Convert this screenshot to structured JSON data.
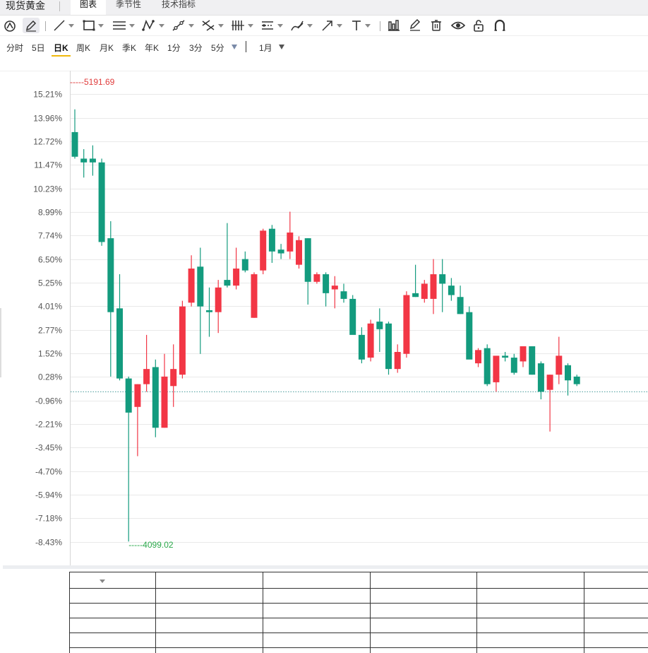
{
  "app": {
    "title": "现货黄金"
  },
  "tabs": [
    {
      "label": "图表",
      "active": true
    },
    {
      "label": "季节性",
      "active": false
    },
    {
      "label": "技术指标",
      "active": false
    }
  ],
  "toolbar": {
    "tools": [
      "magnet-icon",
      "pencil-icon",
      "line-icon",
      "rectangle-icon",
      "parallel-channel-icon",
      "pattern-icon",
      "fib-icon",
      "pitchfork-icon",
      "gann-icon",
      "projection-icon",
      "brush-icon",
      "arrow-icon",
      "text-icon",
      "measure-icon",
      "eraser-icon",
      "trash-icon",
      "eye-icon",
      "lock-icon",
      "magnet-u-icon"
    ]
  },
  "periods": {
    "items": [
      "分时",
      "5日",
      "日K",
      "周K",
      "月K",
      "季K",
      "年K",
      "1分",
      "3分",
      "5分"
    ],
    "active": "日K",
    "range_label": "1月"
  },
  "chart_data": {
    "type": "candlestick",
    "y_axis_format": "percent",
    "ylim": [
      -9.4,
      16.6
    ],
    "y_ticks": [
      "15.21%",
      "13.96%",
      "12.72%",
      "11.47%",
      "10.23%",
      "8.99%",
      "7.74%",
      "6.50%",
      "5.25%",
      "4.01%",
      "2.77%",
      "1.52%",
      "0.28%",
      "-0.96%",
      "-2.21%",
      "-3.45%",
      "-4.70%",
      "-5.94%",
      "-7.18%",
      "-8.43%"
    ],
    "y_tick_values": [
      15.21,
      13.96,
      12.72,
      11.47,
      10.23,
      8.99,
      7.74,
      6.5,
      5.25,
      4.01,
      2.77,
      1.52,
      0.28,
      -0.96,
      -2.21,
      -3.45,
      -4.7,
      -5.94,
      -7.18,
      -8.43
    ],
    "baseline_pct": 0.0,
    "max_label": "5191.69",
    "min_label": "4099.02",
    "up_color": "#f23645",
    "down_color": "#139b7e",
    "candles": [
      {
        "o": 13.2,
        "h": 14.4,
        "l": 11.8,
        "c": 11.9
      },
      {
        "o": 11.8,
        "h": 12.3,
        "l": 10.8,
        "c": 11.6
      },
      {
        "o": 11.8,
        "h": 12.5,
        "l": 10.9,
        "c": 11.6
      },
      {
        "o": 11.6,
        "h": 11.8,
        "l": 7.2,
        "c": 7.4
      },
      {
        "o": 7.6,
        "h": 8.5,
        "l": 0.3,
        "c": 3.7
      },
      {
        "o": 3.9,
        "h": 5.7,
        "l": 0.1,
        "c": 0.2
      },
      {
        "o": 0.2,
        "h": 0.3,
        "l": -8.4,
        "c": -1.6
      },
      {
        "o": -1.3,
        "h": -0.1,
        "l": -3.9,
        "c": -0.1
      },
      {
        "o": -0.1,
        "h": 2.5,
        "l": -0.5,
        "c": 0.7
      },
      {
        "o": 0.8,
        "h": 1.2,
        "l": -2.9,
        "c": -2.4
      },
      {
        "o": -2.4,
        "h": 1.5,
        "l": -2.4,
        "c": 0.3
      },
      {
        "o": -0.2,
        "h": 2.0,
        "l": -1.3,
        "c": 0.7
      },
      {
        "o": 0.4,
        "h": 4.3,
        "l": 0.2,
        "c": 4.0
      },
      {
        "o": 4.2,
        "h": 6.7,
        "l": 4.0,
        "c": 6.0
      },
      {
        "o": 6.1,
        "h": 7.1,
        "l": 1.5,
        "c": 4.0
      },
      {
        "o": 3.8,
        "h": 5.0,
        "l": 2.4,
        "c": 3.7
      },
      {
        "o": 3.7,
        "h": 5.4,
        "l": 2.6,
        "c": 5.0
      },
      {
        "o": 5.4,
        "h": 8.4,
        "l": 5.0,
        "c": 5.1
      },
      {
        "o": 5.1,
        "h": 7.1,
        "l": 4.9,
        "c": 6.0
      },
      {
        "o": 6.5,
        "h": 6.9,
        "l": 5.8,
        "c": 5.9
      },
      {
        "o": 3.4,
        "h": 5.8,
        "l": 3.4,
        "c": 5.7
      },
      {
        "o": 5.9,
        "h": 8.1,
        "l": 5.7,
        "c": 8.0
      },
      {
        "o": 8.1,
        "h": 8.3,
        "l": 6.3,
        "c": 6.9
      },
      {
        "o": 7.0,
        "h": 7.3,
        "l": 6.5,
        "c": 6.8
      },
      {
        "o": 6.9,
        "h": 9.0,
        "l": 6.5,
        "c": 7.9
      },
      {
        "o": 6.2,
        "h": 7.7,
        "l": 6.0,
        "c": 7.5
      },
      {
        "o": 7.6,
        "h": 7.6,
        "l": 4.1,
        "c": 5.3
      },
      {
        "o": 5.3,
        "h": 5.8,
        "l": 5.2,
        "c": 5.7
      },
      {
        "o": 5.7,
        "h": 5.8,
        "l": 4.0,
        "c": 4.7
      },
      {
        "o": 4.9,
        "h": 5.6,
        "l": 3.9,
        "c": 5.1
      },
      {
        "o": 4.8,
        "h": 5.2,
        "l": 4.2,
        "c": 4.4
      },
      {
        "o": 4.4,
        "h": 4.6,
        "l": 2.6,
        "c": 2.5
      },
      {
        "o": 2.5,
        "h": 2.9,
        "l": 1.0,
        "c": 1.2
      },
      {
        "o": 1.3,
        "h": 3.3,
        "l": 1.1,
        "c": 3.1
      },
      {
        "o": 3.2,
        "h": 3.9,
        "l": 1.6,
        "c": 2.8
      },
      {
        "o": 3.1,
        "h": 3.2,
        "l": 0.4,
        "c": 0.7
      },
      {
        "o": 0.7,
        "h": 2.0,
        "l": 0.5,
        "c": 1.6
      },
      {
        "o": 1.5,
        "h": 4.8,
        "l": 1.3,
        "c": 4.6
      },
      {
        "o": 4.7,
        "h": 6.2,
        "l": 4.5,
        "c": 4.5
      },
      {
        "o": 4.4,
        "h": 5.4,
        "l": 4.2,
        "c": 5.2
      },
      {
        "o": 4.4,
        "h": 6.5,
        "l": 3.6,
        "c": 5.7
      },
      {
        "o": 5.7,
        "h": 6.5,
        "l": 3.7,
        "c": 5.2
      },
      {
        "o": 5.1,
        "h": 5.5,
        "l": 4.3,
        "c": 4.6
      },
      {
        "o": 4.5,
        "h": 5.1,
        "l": 3.6,
        "c": 3.6
      },
      {
        "o": 3.7,
        "h": 4.0,
        "l": 1.4,
        "c": 1.2
      },
      {
        "o": 1.0,
        "h": 1.8,
        "l": 0.8,
        "c": 1.7
      },
      {
        "o": 1.8,
        "h": 2.0,
        "l": -0.2,
        "c": -0.1
      },
      {
        "o": 0.0,
        "h": 1.3,
        "l": -0.5,
        "c": 1.4
      },
      {
        "o": 1.4,
        "h": 1.6,
        "l": 1.1,
        "c": 1.3
      },
      {
        "o": 1.3,
        "h": 1.5,
        "l": 0.4,
        "c": 0.5
      },
      {
        "o": 1.1,
        "h": 1.9,
        "l": 0.8,
        "c": 1.9
      },
      {
        "o": 1.9,
        "h": 1.9,
        "l": 0.4,
        "c": 0.4
      },
      {
        "o": 1.0,
        "h": 1.1,
        "l": -0.9,
        "c": -0.5
      },
      {
        "o": -0.4,
        "h": 0.4,
        "l": -2.6,
        "c": 0.4
      },
      {
        "o": 0.4,
        "h": 2.4,
        "l": -0.1,
        "c": 1.4
      },
      {
        "o": 0.9,
        "h": 1.0,
        "l": -0.7,
        "c": 0.1
      },
      {
        "o": 0.3,
        "h": 0.4,
        "l": -0.2,
        "c": -0.1
      }
    ]
  }
}
